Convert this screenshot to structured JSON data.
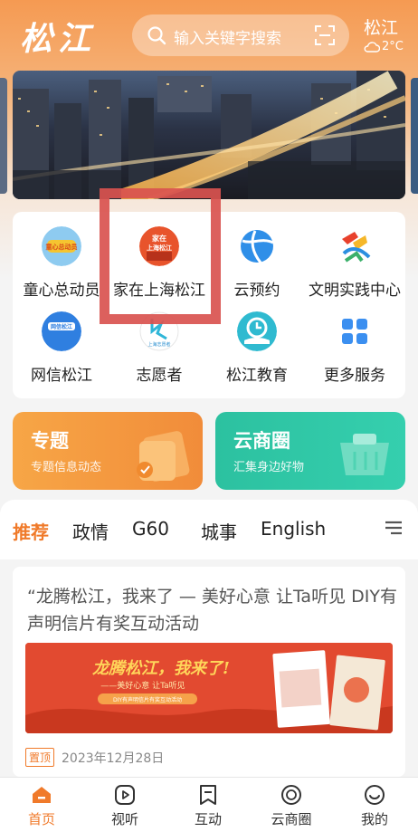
{
  "header": {
    "logo_text": "松江",
    "search_placeholder": "输入关键字搜索",
    "city": "松江",
    "temperature": "2°C"
  },
  "services": [
    {
      "label": "童心总动员",
      "icon": "kids-badge-icon",
      "icon_text": "童心总动员"
    },
    {
      "label": "家在上海松江",
      "icon": "home-shanghai-icon",
      "icon_text": "家在上海松江"
    },
    {
      "label": "云预约",
      "icon": "cloud-booking-icon"
    },
    {
      "label": "文明实践中心",
      "icon": "civilization-center-icon"
    },
    {
      "label": "网信松江",
      "icon": "net-info-icon",
      "icon_text": "网信松江"
    },
    {
      "label": "志愿者",
      "icon": "volunteer-icon",
      "icon_text": "上海志愿者"
    },
    {
      "label": "松江教育",
      "icon": "education-icon"
    },
    {
      "label": "更多服务",
      "icon": "more-services-icon"
    }
  ],
  "promos": [
    {
      "title": "专题",
      "subtitle": "专题信息动态",
      "color": "#f59a3f"
    },
    {
      "title": "云商圈",
      "subtitle": "汇集身边好物",
      "color": "#2ec4a4"
    }
  ],
  "tabs": [
    "推荐",
    "政情",
    "G60",
    "城事",
    "English"
  ],
  "active_tab": "推荐",
  "article": {
    "title": "“龙腾松江，我来了 — 美好心意 让Ta听见 DIY有声明信片有奖互动活动",
    "banner_headline": "龙腾松江，我来了!",
    "banner_sub": "——美好心意 让Ta听见",
    "banner_note": "DIY有声明信片有奖互动活动",
    "pin_label": "置顶",
    "date": "2023年12月28日"
  },
  "bottom_nav": [
    {
      "label": "首页",
      "icon": "home-icon",
      "active": true
    },
    {
      "label": "视听",
      "icon": "play-icon",
      "active": false
    },
    {
      "label": "互动",
      "icon": "bookmark-icon",
      "active": false
    },
    {
      "label": "云商圈",
      "icon": "shop-icon",
      "active": false
    },
    {
      "label": "我的",
      "icon": "profile-icon",
      "active": false
    }
  ],
  "colors": {
    "accent": "#f07a2a",
    "highlight_box": "#d9534f"
  }
}
